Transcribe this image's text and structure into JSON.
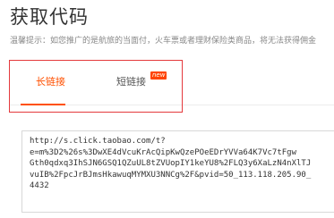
{
  "page": {
    "title": "获取代码",
    "notice": "温馨提示：如您推广的是航旅的当面付，火车票或者理财保险类商品，将无法获得佣金"
  },
  "tabs": {
    "long_label": "长链接",
    "short_label": "短链接",
    "new_badge": "new"
  },
  "link": {
    "lines": [
      "http://s.click.taobao.com/t?",
      "e=m%3D2%26s%3DwXE4dVcuKrAcQipKwQzePOeEDrYVVa64K7Vc7tFgw",
      "Gth0qdxq3IhSJN6GSQ1QZuUL8tZVUopIY1keYU8%2FLQ3y6XaLzN4nXlTJ",
      "vuIB%2FpcJrBJmsHkawuqMYMXU3NNCg%2F&pvid=50_113.118.205.90_",
      "4432"
    ]
  },
  "colors": {
    "accent": "#ff5000",
    "highlight_box": "#e4393c",
    "badge": "#ff4400"
  }
}
